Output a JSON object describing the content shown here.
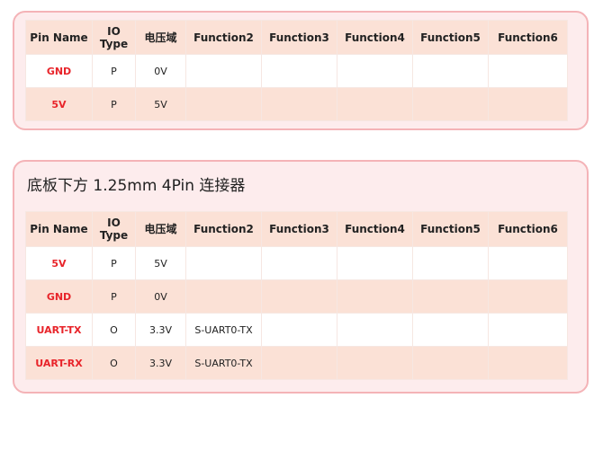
{
  "table1": {
    "headers": [
      "Pin Name",
      "IO\nType",
      "电压域",
      "Function2",
      "Function3",
      "Function4",
      "Function5",
      "Function6"
    ],
    "rows": [
      [
        "GND",
        "P",
        "0V",
        "",
        "",
        "",
        "",
        ""
      ],
      [
        "5V",
        "P",
        "5V",
        "",
        "",
        "",
        "",
        ""
      ]
    ]
  },
  "table2": {
    "title": "底板下方 1.25mm   4Pin  连接器",
    "headers": [
      "Pin Name",
      "IO\nType",
      "电压域",
      "Function2",
      "Function3",
      "Function4",
      "Function5",
      "Function6"
    ],
    "rows": [
      [
        "5V",
        "P",
        "5V",
        "",
        "",
        "",
        "",
        ""
      ],
      [
        "GND",
        "P",
        "0V",
        "",
        "",
        "",
        "",
        ""
      ],
      [
        "UART-TX",
        "O",
        "3.3V",
        "S-UART0-TX",
        "",
        "",
        "",
        ""
      ],
      [
        "UART-RX",
        "O",
        "3.3V",
        "S-UART0-TX",
        "",
        "",
        "",
        ""
      ]
    ]
  },
  "colors": {
    "panel_bg": "#fdeced",
    "panel_border": "#f4b3b7",
    "header_bg": "#fbe1d6",
    "pin_name_red": "#e8242a"
  }
}
